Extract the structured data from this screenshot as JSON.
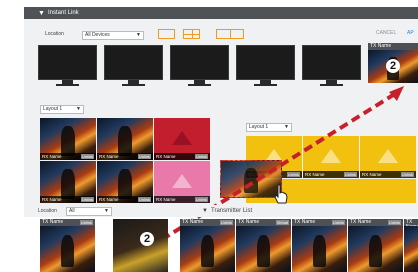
{
  "instant_link": {
    "title": "Instant Link",
    "location_label": "Location",
    "location_value": "All Devices",
    "cancel_label": "CANCEL",
    "apply_label": "AP",
    "tx_name": "TX Name",
    "badge_number": "2"
  },
  "layout": {
    "left_value": "Layout 1",
    "right_value": "Layout 1"
  },
  "video_wall": {
    "cells": [
      {
        "name": "RX Name",
        "button": "Unlink"
      },
      {
        "name": "RX Name",
        "button": "Unlink"
      },
      {
        "name": "RX Name",
        "button": "Unlink"
      },
      {
        "name": "RX Name",
        "button": "Unlink"
      },
      {
        "name": "RX Name",
        "button": "Unlink"
      },
      {
        "name": "RX Name",
        "button": "Unlink"
      }
    ]
  },
  "yellow_wall": {
    "cells": [
      {
        "name": "RX Name",
        "button": "Unlink"
      },
      {
        "name": "RX Name",
        "button": "Unlink"
      },
      {
        "name": "RX Name",
        "button": "Unlink"
      }
    ]
  },
  "transmitter_list": {
    "title": "Transmitter List",
    "location_label": "Location",
    "location_value": "All",
    "tiles": [
      {
        "name": "TX Name",
        "button": "Unlink"
      },
      {
        "name": "",
        "button": ""
      },
      {
        "name": "TX Name",
        "button": "Unlink"
      },
      {
        "name": "TX Name",
        "button": "Virtual"
      },
      {
        "name": "TX Name",
        "button": "Unlink"
      },
      {
        "name": "TX Name",
        "button": "Unlink"
      },
      {
        "name": "TX Name",
        "button": ""
      }
    ]
  },
  "colors": {
    "accent": "#f39a1e",
    "drag_line": "#c8202a",
    "header_bg": "#4f5358"
  }
}
